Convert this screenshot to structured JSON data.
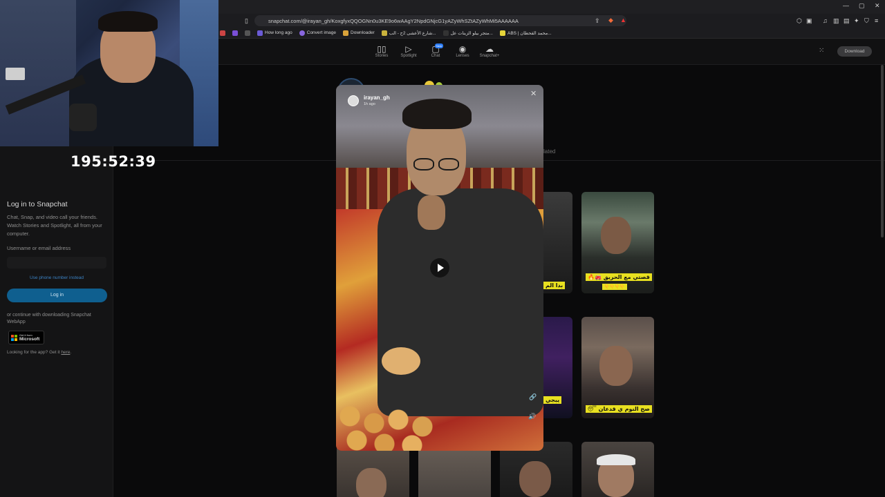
{
  "browser": {
    "url": "snapchat.com/@irayan_gh/KoxgfyxQQOGNn0u3KE9o6wAAgY2NpdGNjcG1yAZyWhSZtAZyWhMi5AAAAAA",
    "bookmarks": [
      "How long ago",
      "Convert image",
      "Downloader",
      "شارع الأعشى 2ج - الب...",
      "متجر بيلو الزينات عل...",
      "ABS | محمد القحطان..."
    ]
  },
  "stream": {
    "timer": "195:52:39"
  },
  "nav": {
    "items": [
      {
        "label": "Stories",
        "icon": "stories-icon"
      },
      {
        "label": "Spotlight",
        "icon": "spotlight-icon"
      },
      {
        "label": "Chat",
        "icon": "chat-icon"
      },
      {
        "label": "Lenses",
        "icon": "lenses-icon"
      },
      {
        "label": "Snapchat+",
        "icon": "ghost-icon"
      }
    ],
    "new_badge": "New",
    "download_label": "Download"
  },
  "login": {
    "title": "Log in to Snapchat",
    "description": "Chat, Snap, and video call your friends. Watch Stories and Spotlight, all from your computer.",
    "username_label": "Username or email address",
    "phone_link": "Use phone number instead",
    "login_button": "Log in",
    "or_text": "or continue with downloading Snapchat WebApp",
    "ms_small": "Get it from",
    "ms_big": "Microsoft",
    "app_text": "Looking for the app? Get it",
    "app_link": "here"
  },
  "main": {
    "related_tab": "lated",
    "captions": {
      "c1": "قصتي مع الحريق 🚒🔥",
      "c1b": "👇👇👇👇",
      "c2": "بدا الم",
      "c3": "صح النوم ي قدعان 😴",
      "c4": "يبجي"
    }
  },
  "story": {
    "author": "irayan_gh",
    "time": "1h ago"
  }
}
